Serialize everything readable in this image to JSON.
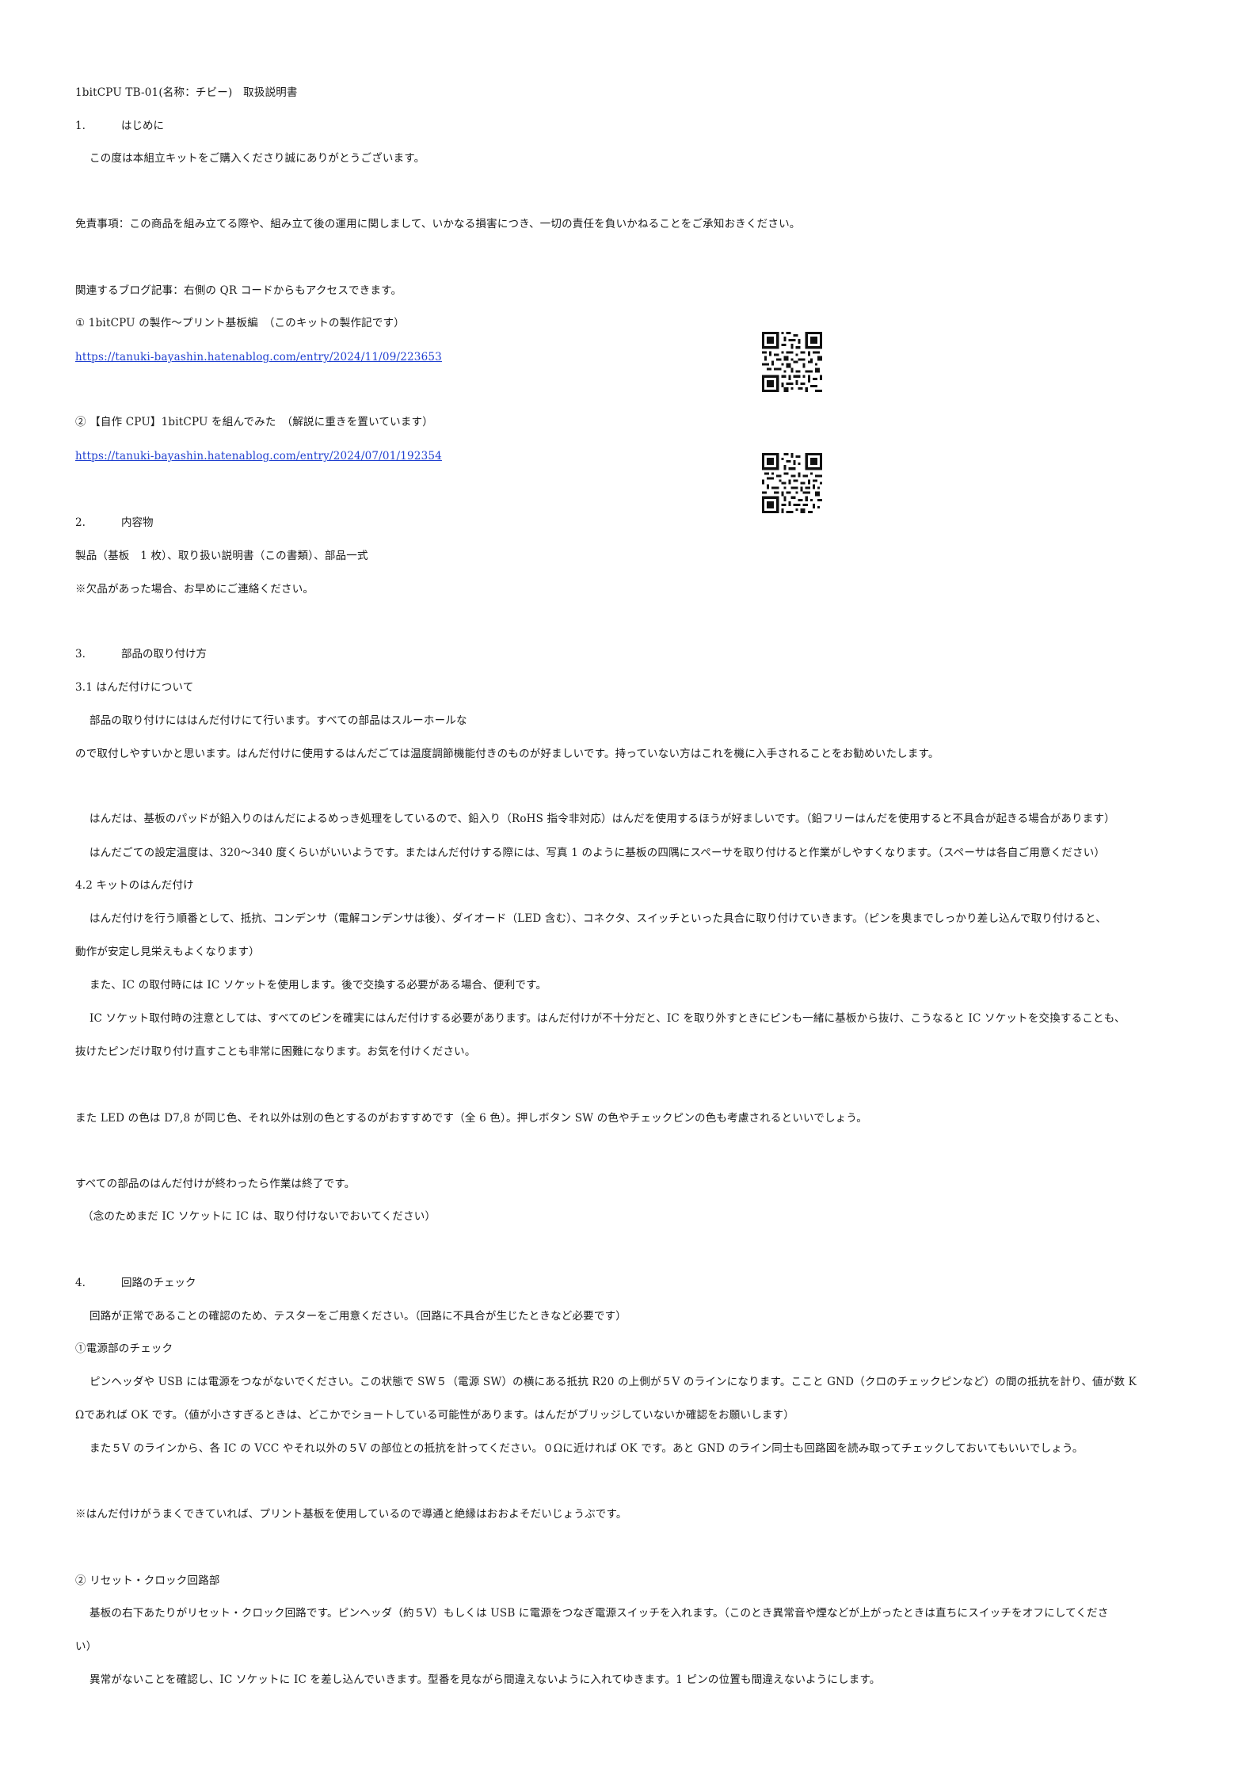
{
  "title": "1bitCPU TB-01(名称：チビー)　取扱説明書",
  "s1": {
    "num": "1.",
    "heading": "はじめに"
  },
  "thanks": "この度は本組立キットをご購入くださり誠にありがとうございます。",
  "disclaimer": "免責事項：この商品を組み立てる際や、組み立て後の運用に関しまして、いかなる損害につき、一切の責任を負いかねることをご承知おきください。",
  "blog_intro": "関連するブログ記事：右側の QR コードからもアクセスできます。",
  "blog1": {
    "label": "①  1bitCPU の製作～プリント基板編　（このキットの製作記です）",
    "url": "https://tanuki-bayashin.hatenablog.com/entry/2024/11/09/223653"
  },
  "blog2": {
    "label": "②  【自作 CPU】1bitCPU を組んでみた　（解説に重きを置いています）",
    "url": "https://tanuki-bayashin.hatenablog.com/entry/2024/07/01/192354"
  },
  "s2": {
    "num": "2.",
    "heading": "内容物"
  },
  "contents": "製品（基板　1 枚）、取り扱い説明書（この書類）、部品一式",
  "missing": "※欠品があった場合、お早めにご連絡ください。",
  "s3": {
    "num": "3.",
    "heading": "部品の取り付け方"
  },
  "s31": "3.1  はんだ付けについて",
  "p31a": "部品の取り付けにははんだ付けにて行います。すべての部品はスルーホールな",
  "p31b": "ので取付しやすいかと思います。はんだ付けに使用するはんだごては温度調節機能付きのものが好ましいです。持っていない方はこれを機に入手されることをお勧めいたします。",
  "p31c": "はんだは、基板のパッドが鉛入りのはんだによるめっき処理をしているので、鉛入り（RoHS 指令非対応）はんだを使用するほうが好ましいです。（鉛フリーはんだを使用すると不具合が起きる場合があります）",
  "p31d": "はんだごての設定温度は、320～340 度くらいがいいようです。またはんだ付けする際には、写真 1 のように基板の四隅にスペーサを取り付けると作業がしやすくなります。（スペーサは各自ご用意ください）",
  "s42": "4.2  キットのはんだ付け",
  "p42a": "はんだ付けを行う順番として、抵抗、コンデンサ（電解コンデンサは後）、ダイオード（LED 含む）、コネクタ、スイッチといった具合に取り付けていきます。（ピンを奥までしっかり差し込んで取り付けると、",
  "p42b": "動作が安定し見栄えもよくなります）",
  "p42c": "また、IC の取付時には IC ソケットを使用します。後で交換する必要がある場合、便利です。",
  "p42d": "IC ソケット取付時の注意としては、すべてのピンを確実にはんだ付けする必要があります。はんだ付けが不十分だと、IC を取り外すときにピンも一緒に基板から抜け、こうなると IC ソケットを交換することも、",
  "p42e": "抜けたピンだけ取り付け直すことも非常に困難になります。お気を付けください。",
  "p42f": "また LED の色は D7,8 が同じ色、それ以外は別の色とするのがおすすめです（全 6 色）。押しボタン SW の色やチェックピンの色も考慮されるといいでしょう。",
  "p42g": "すべての部品のはんだ付けが終わったら作業は終了です。",
  "p42h": "（念のためまだ IC ソケットに IC は、取り付けないでおいてください）",
  "s4": {
    "num": "4.",
    "heading": "回路のチェック"
  },
  "p4a": "回路が正常であることの確認のため、テスターをご用意ください。（回路に不具合が生じたときなど必要です）",
  "c1": "①電源部のチェック",
  "p4b": "ピンヘッダや USB には電源をつながないでください。この状態で SW５（電源 SW）の横にある抵抗 R20 の上側が５V のラインになります。ここと GND（クロのチェックピンなど）の間の抵抗を計り、値が数 K",
  "p4c": "Ωであれば OK です。（値が小さすぎるときは、どこかでショートしている可能性があります。はんだがブリッジしていないか確認をお願いします）",
  "p4d": "また５V のラインから、各 IC の VCC やそれ以外の５V の部位との抵抗を計ってください。０Ωに近ければ OK です。あと GND のライン同士も回路図を読み取ってチェックしておいてもいいでしょう。",
  "p4e": "※はんだ付けがうまくできていれば、プリント基板を使用しているので導通と絶縁はおおよそだいじょうぶです。",
  "c2": "②  リセット・クロック回路部",
  "p4f": "基板の右下あたりがリセット・クロック回路です。ピンヘッダ（約５V）もしくは USB に電源をつなぎ電源スイッチを入れます。（このとき異常音や煙などが上がったときは直ちにスイッチをオフにしてくださ",
  "p4g": "い）",
  "p4h": "異常がないことを確認し、IC ソケットに IC を差し込んでいきます。型番を見ながら間違えないように入れてゆきます。1 ピンの位置も間違えないようにします。"
}
